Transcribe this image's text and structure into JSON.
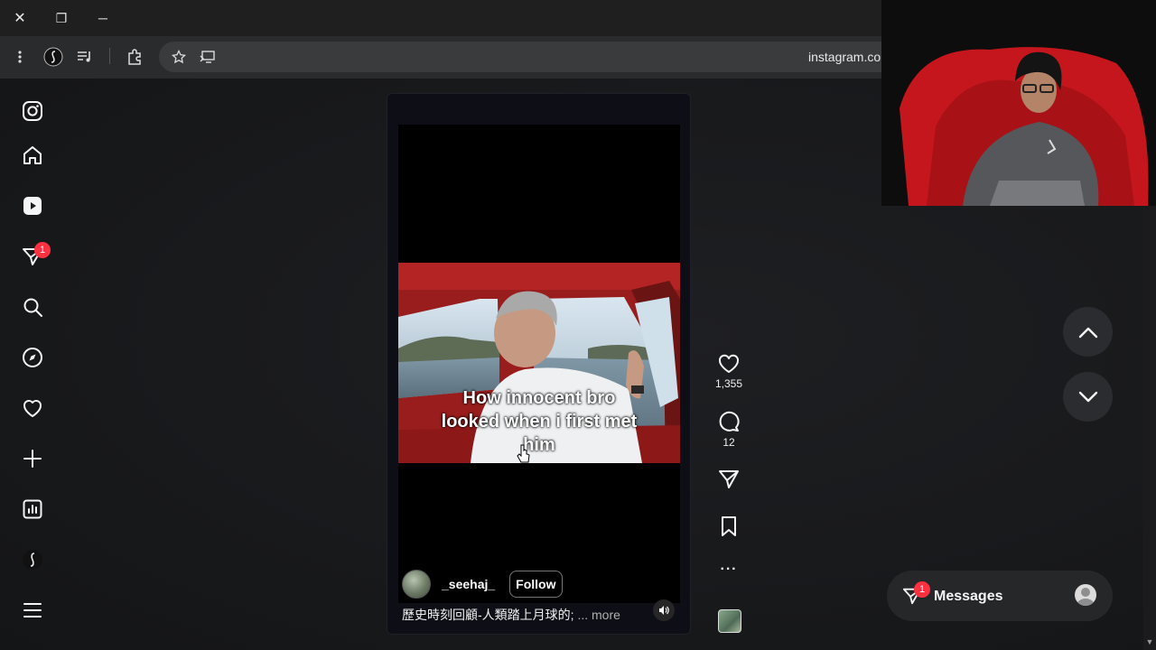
{
  "browser": {
    "url": "instagram.com",
    "close_glyph": "✕",
    "restore_glyph": "❐",
    "minimize_glyph": "─"
  },
  "sidebar": {
    "notification_count": "1"
  },
  "reel": {
    "overlay_text": [
      "How innocent bro",
      "looked when i first met",
      "him"
    ],
    "username": "_seehaj_",
    "follow_label": "Follow",
    "description": "歷史時刻回顧-人類踏上月球的;",
    "more_label": "... more"
  },
  "actions": {
    "likes": "1,355",
    "comments": "12",
    "more_glyph": "···"
  },
  "messages": {
    "label": "Messages",
    "badge": "1"
  },
  "colors": {
    "badge_red": "#ff3040",
    "background": "#1a1b1d"
  }
}
